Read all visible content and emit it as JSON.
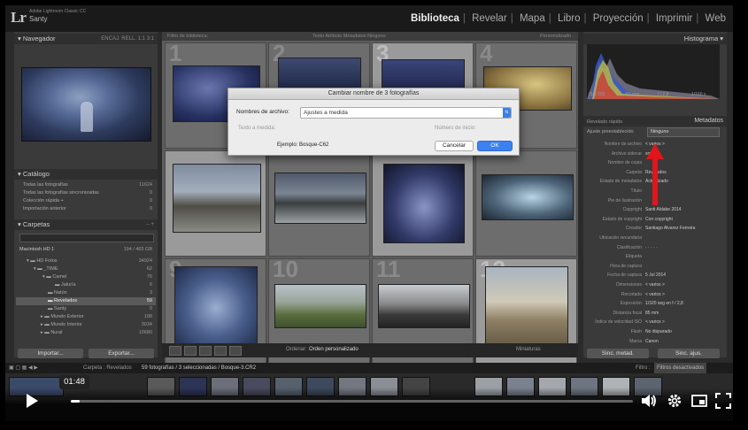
{
  "app": {
    "logo": "Lr",
    "subtitle": "Adobe Lightroom Classic CC",
    "user": "Santy"
  },
  "modules": [
    "Biblioteca",
    "Revelar",
    "Mapa",
    "Libro",
    "Proyección",
    "Imprimir",
    "Web"
  ],
  "active_module": "Biblioteca",
  "left": {
    "navigator": {
      "title": "Navegador",
      "zoom": "ENCAJ. RELL. 1:1 3:1"
    },
    "catalog": {
      "title": "Catálogo",
      "items": [
        {
          "label": "Todas las fotografías",
          "count": "11624"
        },
        {
          "label": "Todas las fotografías sincronizadas",
          "count": "0"
        },
        {
          "label": "Colección rápida +",
          "count": "0"
        },
        {
          "label": "Importación anterior",
          "count": "0"
        }
      ]
    },
    "folders": {
      "title": "Carpetas",
      "drive": "Macintosh HD 1",
      "drive_size": "194 / 465 GB",
      "items": [
        {
          "label": "HD Fotos",
          "count": "34924"
        },
        {
          "label": "_TIME",
          "count": "62"
        },
        {
          "label": "Camel",
          "count": "76"
        },
        {
          "label": "Jaluría",
          "count": "6"
        },
        {
          "label": "Natún",
          "count": "3"
        },
        {
          "label": "Revelados",
          "count": "59"
        },
        {
          "label": "Santy",
          "count": "0"
        },
        {
          "label": "Mundo Exterior",
          "count": "108"
        },
        {
          "label": "Mundo Interior",
          "count": "3034"
        },
        {
          "label": "Nural",
          "count": "10680"
        }
      ]
    },
    "import_label": "Importar...",
    "export_label": "Exportar..."
  },
  "grid": {
    "head_left": "Filtro de biblioteca:",
    "head_tabs": "Texto   Atributo   Metadatos   Ninguno",
    "head_right": "Personalizado",
    "numbers": [
      "1",
      "2",
      "3",
      "4",
      "",
      "",
      "",
      "",
      "9",
      "10",
      "11",
      "12"
    ]
  },
  "toolbar": {
    "sort_label": "Ordenar:",
    "sort_value": "Orden personalizado",
    "thumbs_label": "Miniaturas"
  },
  "dialog": {
    "title": "Cambiar nombre de 3 fotografías",
    "field_label": "Nombres de archivo:",
    "field_value": "Ajustes a medida",
    "custom_text_label": "Texto a medida:",
    "start_number_label": "Número de inicio:",
    "example": "Ejemplo: Bosque-C62",
    "cancel": "Cancelar",
    "ok": "OK"
  },
  "right": {
    "histogram_title": "Histograma",
    "histo_info": [
      "ISO 200",
      "50 mm",
      "f / 2,8",
      "1/160 s"
    ],
    "quick_develop": "Revelado rápido",
    "metadata_title": "Metadatos",
    "metadata_preset_label": "Ajuste preestablecido",
    "metadata_preset_value": "Ninguno",
    "rows": [
      {
        "label": "Nombre de archivo",
        "value": "< varios >"
      },
      {
        "label": "Archivo sidecar",
        "value": "xmp"
      },
      {
        "label": "Nombre de copia",
        "value": ""
      },
      {
        "label": "Carpeta",
        "value": "Revelados"
      },
      {
        "label": "Estado de metadatos",
        "value": "Actualizado"
      },
      {
        "label": "Título",
        "value": ""
      },
      {
        "label": "Pie de ilustración",
        "value": ""
      },
      {
        "label": "Copyright",
        "value": "Santi Aldabe 2014"
      },
      {
        "label": "Estado de copyright",
        "value": "Con copyright"
      },
      {
        "label": "Creador",
        "value": "Santiago Alvarez Ferreira"
      },
      {
        "label": "Ubicación secundaria",
        "value": ""
      },
      {
        "label": "Clasificación",
        "value": "· · · · ·"
      },
      {
        "label": "Etiqueta",
        "value": ""
      },
      {
        "label": "Hora de captura",
        "value": ""
      },
      {
        "label": "Fecha de captura",
        "value": "5 Jul 2014"
      },
      {
        "label": "Dimensiones",
        "value": "< varios >"
      },
      {
        "label": "Recortado",
        "value": "< varios >"
      },
      {
        "label": "Exposición",
        "value": "1/320 seg en f / 2,8"
      },
      {
        "label": "Distancia focal",
        "value": "85 mm"
      },
      {
        "label": "Índice de velocidad ISO",
        "value": "< varios >"
      },
      {
        "label": "Flash",
        "value": "No disparado"
      },
      {
        "label": "Marca",
        "value": "Canon"
      }
    ],
    "sync_label": "Sinc. metad.",
    "sync_settings_label": "Sinc. ajus."
  },
  "filmbar": {
    "source": "Carpeta : Revelados",
    "info": "59 fotografías / 3 seleccionadas / Bosque-3.CR2",
    "filter_label": "Filtro :",
    "filter_value": "Filtros desactivados"
  },
  "video": {
    "time": "01:48",
    "progress": 0.015
  }
}
